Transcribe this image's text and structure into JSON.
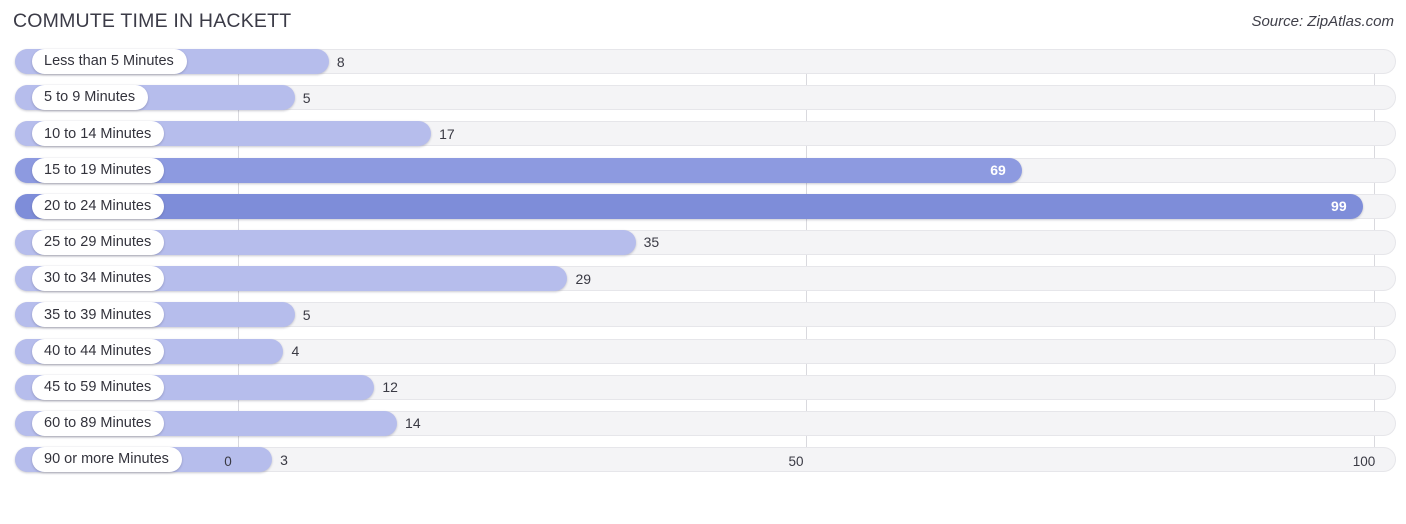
{
  "header": {
    "title": "COMMUTE TIME IN HACKETT",
    "source": "Source: ZipAtlas.com"
  },
  "colors": {
    "bar_light": "#b6bdec",
    "bar_mid": "#8d9ae0",
    "bar_dark": "#7e8dd9",
    "track": "#f4f4f6",
    "track_border": "#e6e6ea",
    "gridline": "#d9d9de",
    "text": "#33333c",
    "value_in_text": "#ffffff"
  },
  "chart_data": {
    "type": "bar",
    "orientation": "horizontal",
    "title": "COMMUTE TIME IN HACKETT",
    "xlabel": "",
    "ylabel": "",
    "xlim": [
      0,
      100
    ],
    "ticks": [
      "0",
      "50",
      "100"
    ],
    "tick_values": [
      0,
      50,
      100
    ],
    "grid": true,
    "legend": false,
    "categories": [
      "Less than 5 Minutes",
      "5 to 9 Minutes",
      "10 to 14 Minutes",
      "15 to 19 Minutes",
      "20 to 24 Minutes",
      "25 to 29 Minutes",
      "30 to 34 Minutes",
      "35 to 39 Minutes",
      "40 to 44 Minutes",
      "45 to 59 Minutes",
      "60 to 89 Minutes",
      "90 or more Minutes"
    ],
    "values": [
      8,
      5,
      17,
      69,
      99,
      35,
      29,
      5,
      4,
      12,
      14,
      3
    ],
    "value_labels": [
      "8",
      "5",
      "17",
      "69",
      "99",
      "35",
      "29",
      "5",
      "4",
      "12",
      "14",
      "3"
    ],
    "label_inside": [
      false,
      false,
      false,
      true,
      true,
      false,
      false,
      false,
      false,
      false,
      false,
      false
    ]
  }
}
